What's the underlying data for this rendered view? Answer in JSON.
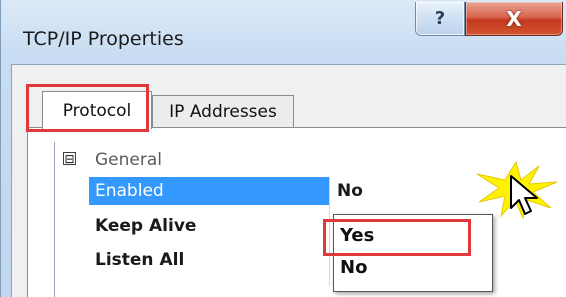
{
  "window": {
    "title": "TCP/IP Properties",
    "help_glyph": "?",
    "close_glyph": "X"
  },
  "tabs": [
    {
      "label": "Protocol",
      "selected": true
    },
    {
      "label": "IP Addresses",
      "selected": false
    }
  ],
  "grid": {
    "category": {
      "label": "General",
      "expander": "⊟"
    },
    "properties": [
      {
        "name": "Enabled",
        "value": "No",
        "selected": true
      },
      {
        "name": "Keep Alive",
        "value": "",
        "selected": false
      },
      {
        "name": "Listen All",
        "value": "",
        "selected": false
      }
    ]
  },
  "dropdown": {
    "options": [
      "Yes",
      "No"
    ],
    "highlighted": "Yes"
  },
  "colors": {
    "highlight_box": "#e0393b",
    "selection": "#3399ff",
    "close_button": "#c2391f"
  }
}
